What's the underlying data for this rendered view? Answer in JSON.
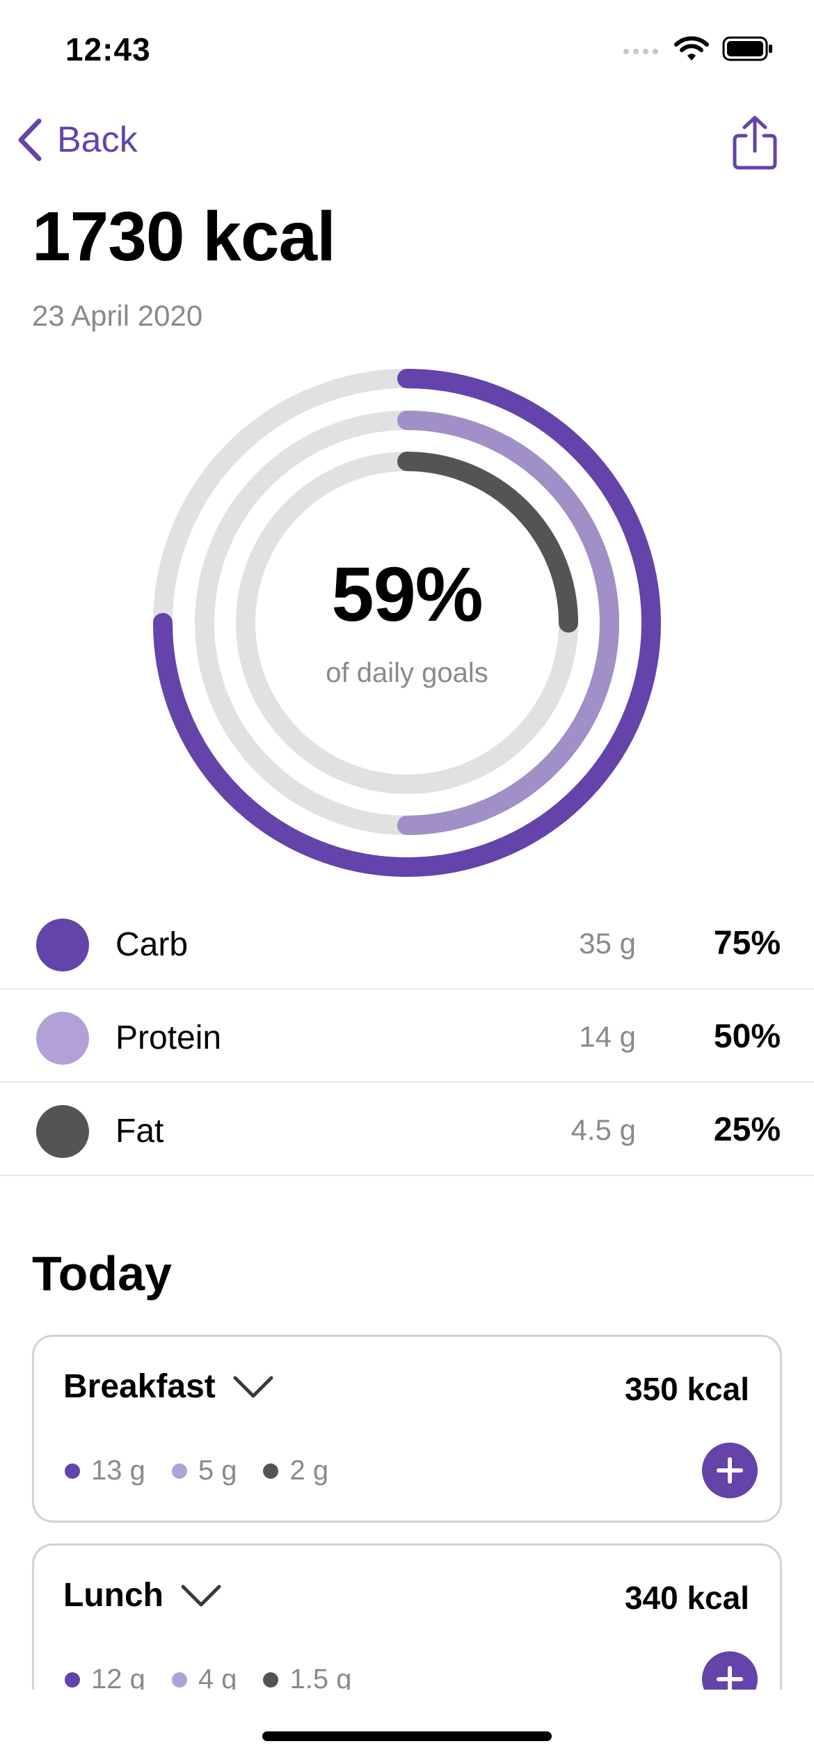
{
  "status_bar": {
    "time": "12:43"
  },
  "nav": {
    "back_label": "Back"
  },
  "header": {
    "title": "1730 kcal",
    "date": "23 April 2020"
  },
  "summary": {
    "percent": "59%",
    "subtitle": "of daily goals",
    "rings": [
      {
        "name": "Carb",
        "fraction": 0.75,
        "color": "#6443ab"
      },
      {
        "name": "Protein",
        "fraction": 0.5,
        "color": "#a18fc8"
      },
      {
        "name": "Fat",
        "fraction": 0.25,
        "color": "#545456"
      }
    ],
    "track_color": "#e1e1e4"
  },
  "macros": [
    {
      "name": "Carb",
      "grams": "35 g",
      "percent": "75%",
      "color": "#6443ab"
    },
    {
      "name": "Protein",
      "grams": "14 g",
      "percent": "50%",
      "color": "#b1a1d6"
    },
    {
      "name": "Fat",
      "grams": "4.5 g",
      "percent": "25%",
      "color": "#545456"
    }
  ],
  "today": {
    "heading": "Today",
    "meals": [
      {
        "name": "Breakfast",
        "kcal": "350 kcal",
        "carb": "13 g",
        "protein": "5 g",
        "fat": "2 g"
      },
      {
        "name": "Lunch",
        "kcal": "340 kcal",
        "carb": "12 g",
        "protein": "4 g",
        "fat": "1.5 g"
      }
    ]
  },
  "colors": {
    "accent": "#6443ab",
    "secondary_text": "#8a8a8e",
    "divider": "#e6e6e6"
  }
}
